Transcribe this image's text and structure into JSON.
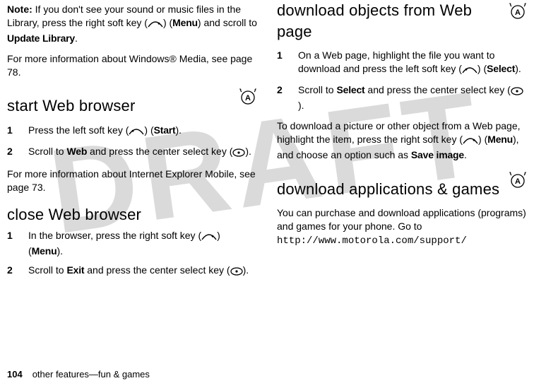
{
  "watermark": "DRAFT",
  "left": {
    "note_label": "Note:",
    "note_text": " If you don't see your sound or music files in the Library, press the right soft key (",
    "note_text2": ") (",
    "menu": "Menu",
    "note_text3": ") and scroll to ",
    "update_library": "Update Library",
    "note_text4": ".",
    "wm_info": "For more information about Windows® Media, see page 78.",
    "start_heading": "start Web browser",
    "step1a": "Press the left soft key (",
    "step1b": ") (",
    "start_label": "Start",
    "step1c": ").",
    "step2a": "Scroll to ",
    "web_label": "Web",
    "step2b": " and press the center select key (",
    "step2c": ").",
    "ie_info": "For more information about Internet Explorer Mobile, see page 73.",
    "close_heading": "close Web browser",
    "cstep1a": "In the browser, press the right soft key (",
    "cstep1b": ") (",
    "cstep1c": ").",
    "cstep2a": "Scroll to ",
    "exit_label": "Exit",
    "cstep2b": " and press the center select key (",
    "cstep2c": ")."
  },
  "right": {
    "dl_heading": "download objects from Web page",
    "d1a": "On a Web page, highlight the file you want to download and press the left soft key (",
    "d1b": ") (",
    "select_label": "Select",
    "d1c": ").",
    "d2a": "Scroll to ",
    "d2b": " and press the center select key (",
    "d2c": ").",
    "dl_para_a": "To download a picture or other object from a Web page, highlight the item, press the right soft key (",
    "dl_para_b": ") (",
    "dl_para_c": "), and choose an option such as ",
    "save_image": "Save image",
    "dl_para_d": ".",
    "apps_heading": "download applications & games",
    "apps_para": "You can purchase and download applications (programs) and games for your phone. Go to ",
    "url": "http://www.motorola.com/support/"
  },
  "footer": {
    "page_no": "104",
    "section": "other features—fun & games"
  }
}
